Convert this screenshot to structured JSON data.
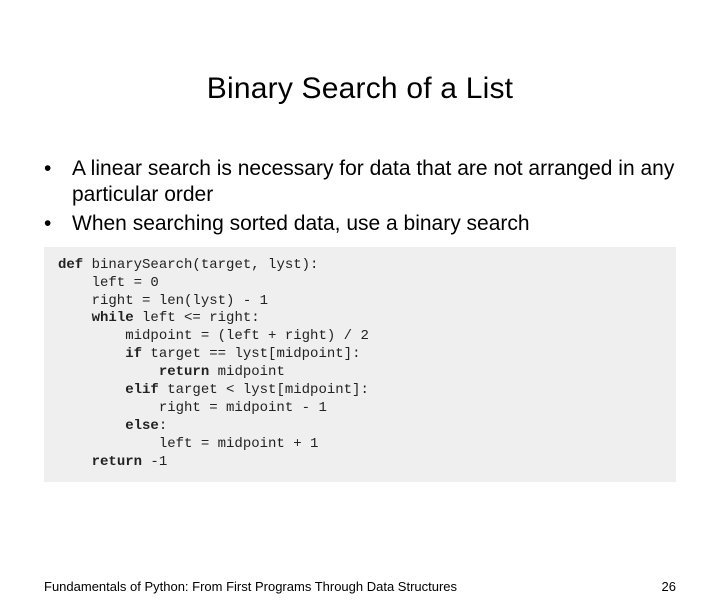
{
  "title": "Binary Search of a List",
  "bullets": [
    "A linear search is necessary for data that are not arranged in any particular order",
    "When searching sorted data, use a binary search"
  ],
  "code": {
    "l1a": "def",
    "l1b": " binarySearch(target, lyst):",
    "l2": "    left = 0",
    "l3": "    right = len(lyst) - 1",
    "l4a": "    ",
    "l4b": "while",
    "l4c": " left <= right:",
    "l5": "        midpoint = (left + right) / 2",
    "l6a": "        ",
    "l6b": "if",
    "l6c": " target == lyst[midpoint]:",
    "l7a": "            ",
    "l7b": "return",
    "l7c": " midpoint",
    "l8a": "        ",
    "l8b": "elif",
    "l8c": " target < lyst[midpoint]:",
    "l9": "            right = midpoint - 1",
    "l10a": "        ",
    "l10b": "else",
    "l10c": ":",
    "l11": "            left = midpoint + 1",
    "l12a": "    ",
    "l12b": "return",
    "l12c": " -1"
  },
  "footer_text": "Fundamentals of Python: From First Programs Through Data Structures",
  "page_number": "26"
}
